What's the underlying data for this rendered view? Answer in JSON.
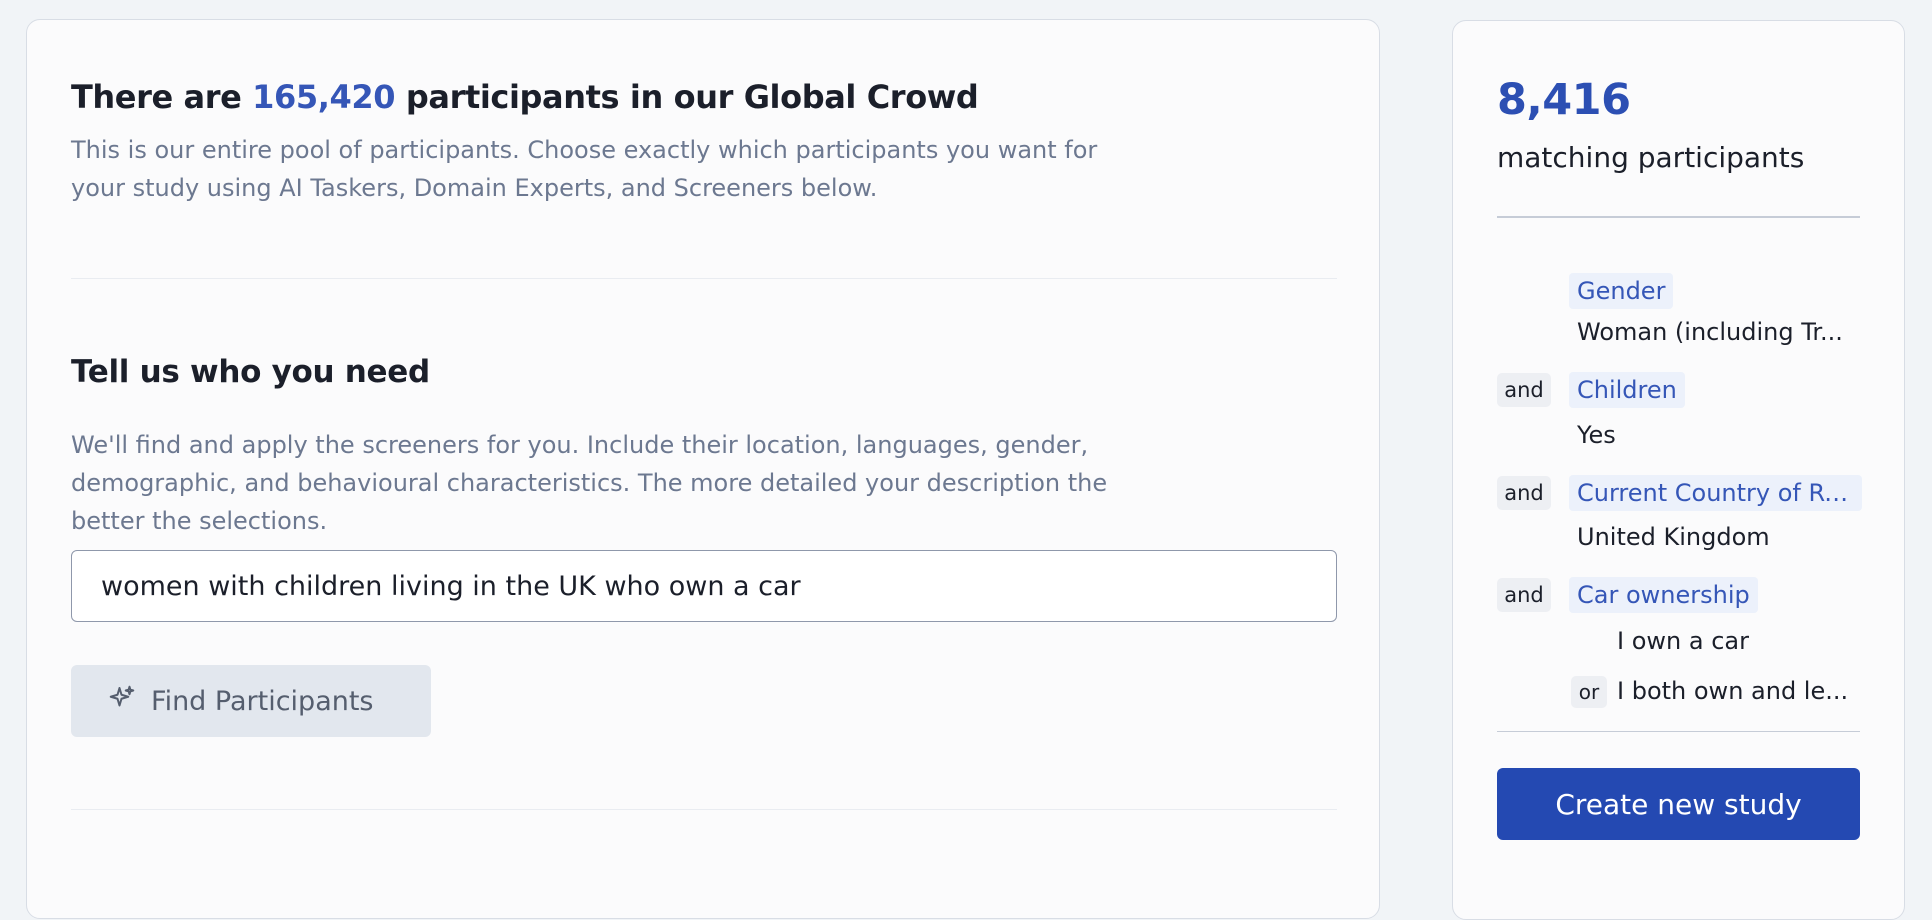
{
  "pool": {
    "headline_prefix": "There are ",
    "participant_count": "165,420",
    "headline_suffix": " participants in our Global Crowd",
    "description": "This is our entire pool of participants. Choose exactly which participants you want for your study using AI Taskers, Domain Experts, and Screeners below."
  },
  "request": {
    "title": "Tell us who you need",
    "description": "We'll find and apply the screeners for you. Include their location, languages, gender, demographic, and behavioural characteristics. The more detailed your description the better the selections.",
    "query_value": "women with children living in the UK who own a car",
    "find_button_label": "Find Participants",
    "find_button_icon": "sparkle-icon"
  },
  "summary": {
    "matching_count": "8,416",
    "matching_label": "matching participants",
    "and_label": "and",
    "or_label": "or",
    "filters": [
      {
        "name": "Gender",
        "values": [
          "Woman (including Tr..."
        ]
      },
      {
        "name": "Children",
        "values": [
          "Yes"
        ]
      },
      {
        "name": "Current Country of Re...",
        "values": [
          "United Kingdom"
        ]
      },
      {
        "name": "Car ownership",
        "values": [
          "I own a car",
          "I both own and le..."
        ]
      }
    ],
    "create_button_label": "Create new study"
  },
  "colors": {
    "accent": "#3556b7",
    "primary_button": "#2449b2",
    "muted_text": "#6c7890",
    "page_background": "#f1f4f7"
  }
}
